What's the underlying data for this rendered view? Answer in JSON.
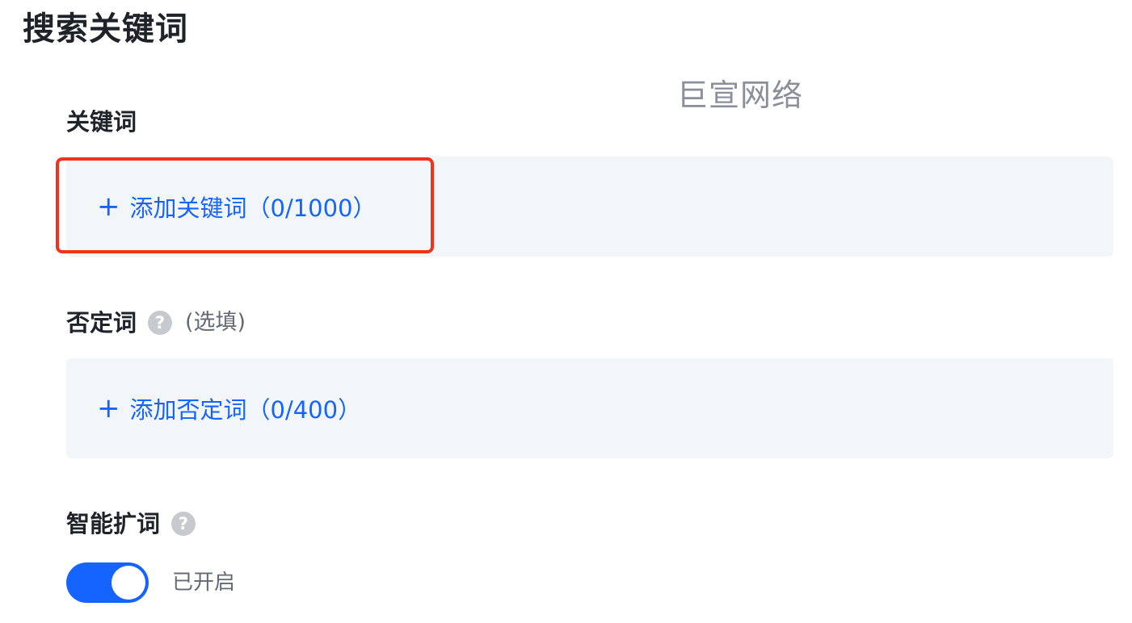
{
  "page": {
    "title": "搜索关键词",
    "watermark": "巨宣网络"
  },
  "keywords": {
    "label": "关键词",
    "add_icon": "plus-icon",
    "add_label": "添加关键词（0/1000）"
  },
  "negative_words": {
    "label": "否定词",
    "help_icon": "question-circle-icon",
    "optional": "(选填)",
    "add_icon": "plus-icon",
    "add_label": "添加否定词（0/400）"
  },
  "smart_expand": {
    "label": "智能扩词",
    "help_icon": "question-circle-icon",
    "enabled": true,
    "status": "已开启"
  },
  "colors": {
    "accent": "#1664ff",
    "highlight": "#f5311b",
    "box_bg": "#f3f6f9"
  }
}
